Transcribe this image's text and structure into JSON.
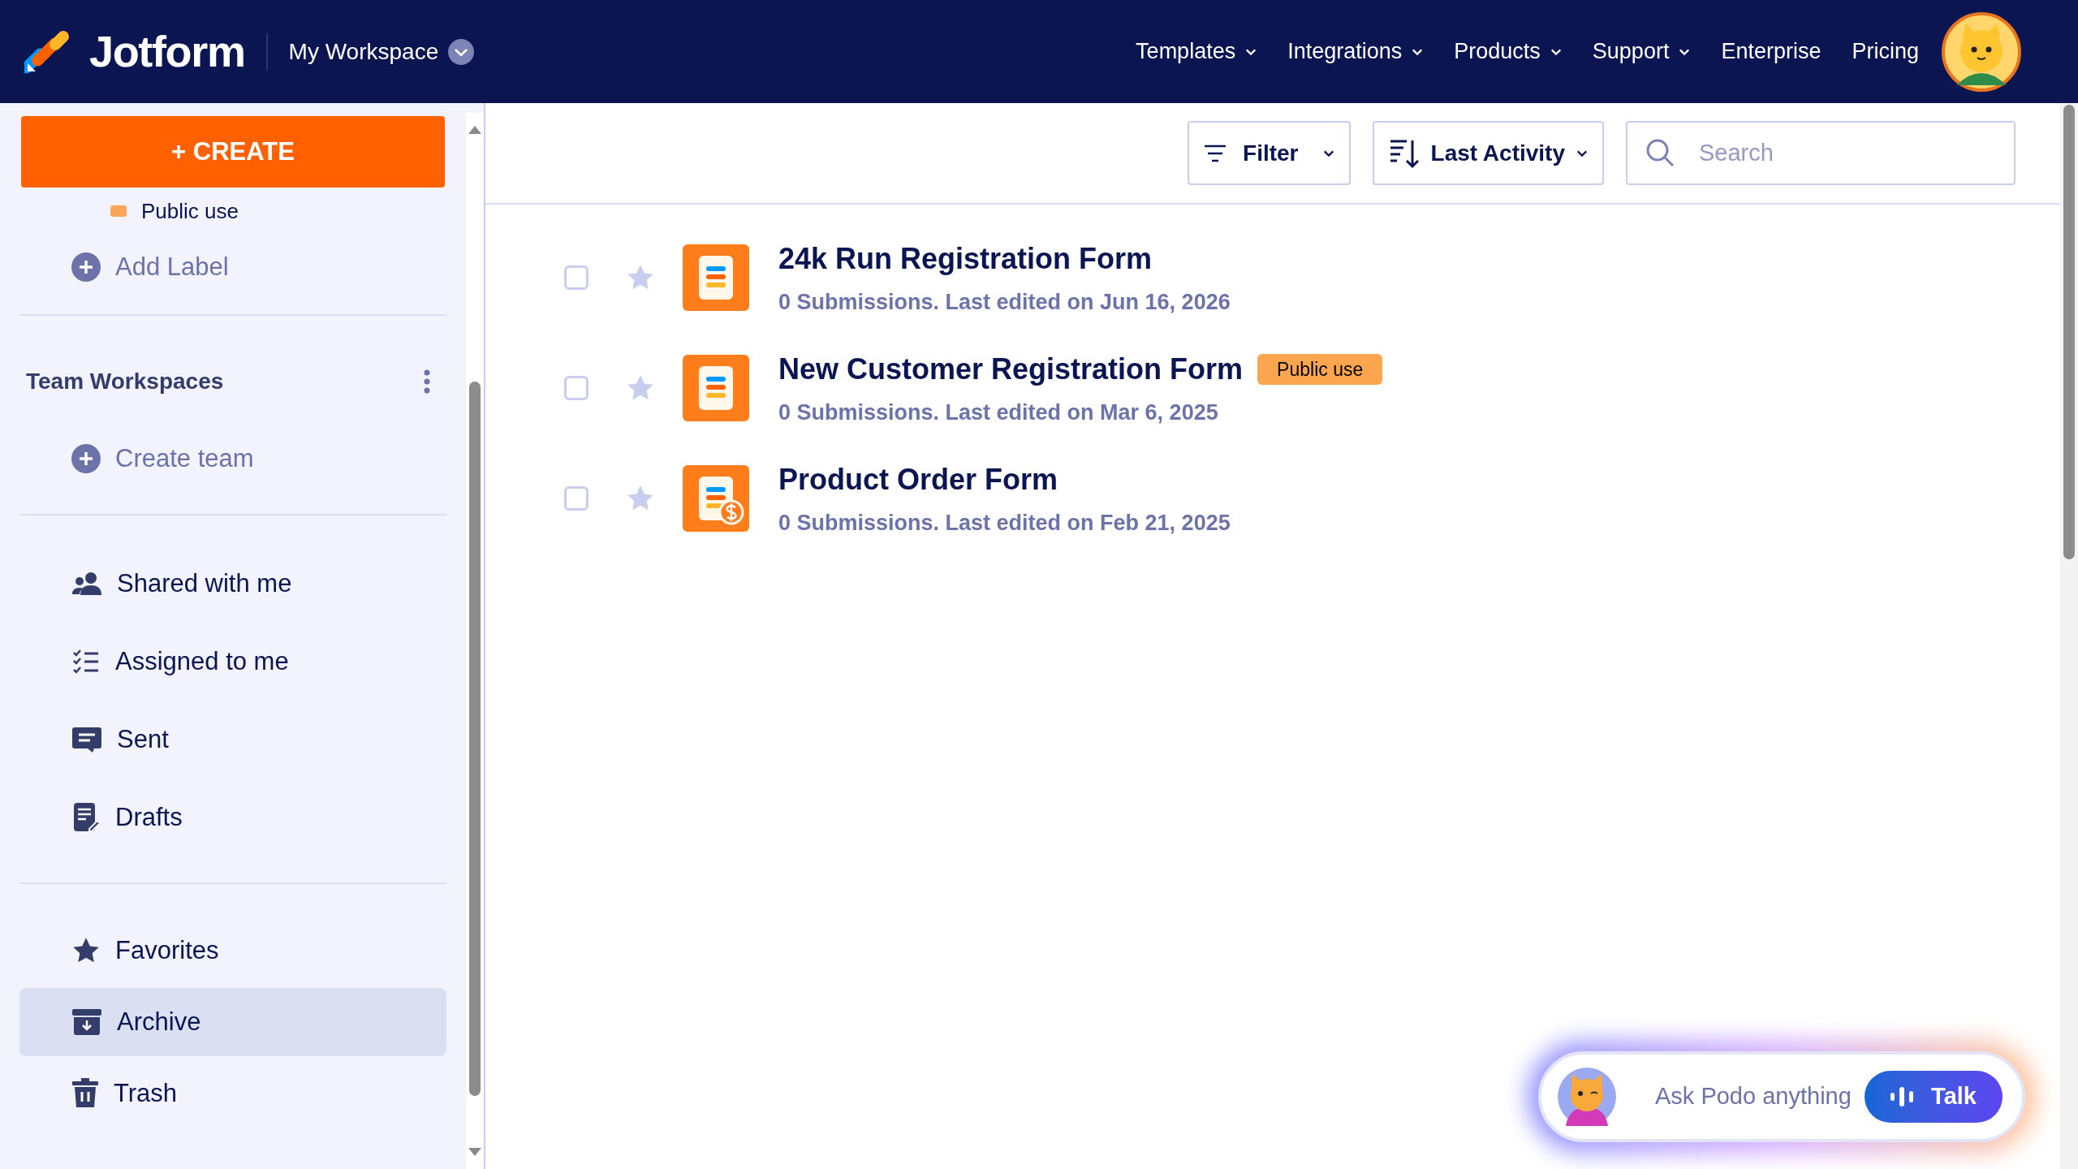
{
  "header": {
    "logo": "Jotform",
    "workspace": "My Workspace",
    "nav": [
      {
        "label": "Templates",
        "has_menu": true
      },
      {
        "label": "Integrations",
        "has_menu": true
      },
      {
        "label": "Products",
        "has_menu": true
      },
      {
        "label": "Support",
        "has_menu": true
      },
      {
        "label": "Enterprise",
        "has_menu": false
      },
      {
        "label": "Pricing",
        "has_menu": false
      }
    ]
  },
  "sidebar": {
    "create_button": "+ CREATE",
    "labels": [
      {
        "label": "Public use",
        "color": "#f9a65a"
      }
    ],
    "add_label": "Add Label",
    "team_heading": "Team Workspaces",
    "create_team": "Create team",
    "sections": [
      [
        {
          "label": "Shared with me",
          "kind": "shared",
          "selected": false
        },
        {
          "label": "Assigned to me",
          "kind": "assigned",
          "selected": false
        },
        {
          "label": "Sent",
          "kind": "sent",
          "selected": false
        },
        {
          "label": "Drafts",
          "kind": "drafts",
          "selected": false
        }
      ],
      [
        {
          "label": "Favorites",
          "kind": "favorites",
          "selected": false
        },
        {
          "label": "Archive",
          "kind": "archive",
          "selected": true
        },
        {
          "label": "Trash",
          "kind": "trash",
          "selected": false
        }
      ]
    ]
  },
  "toolbar": {
    "filter": "Filter",
    "sort": "Last Activity",
    "search": {
      "placeholder": "Search"
    }
  },
  "forms": [
    {
      "title": "24k Run Registration Form",
      "subtitle": "0 Submissions. Last edited on Jun 16, 2026",
      "kind": "form",
      "checked": false,
      "starred": false
    },
    {
      "title": "New Customer Registration Form",
      "badge": "Public use",
      "subtitle": "0 Submissions. Last edited on Mar 6, 2025",
      "kind": "form",
      "checked": false,
      "starred": false
    },
    {
      "title": "Product Order Form",
      "subtitle": "0 Submissions. Last edited on Feb 21, 2025",
      "kind": "payment",
      "checked": false,
      "starred": false
    }
  ],
  "assistant": {
    "prompt": "Ask Podo anything",
    "button": "Talk"
  }
}
